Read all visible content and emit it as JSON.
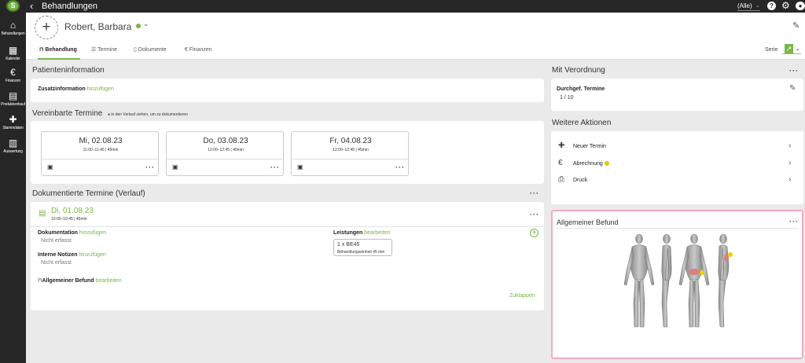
{
  "topbar": {
    "logo": "S",
    "title": "Behandlungen",
    "filter": "(Alle)"
  },
  "sidebar": {
    "items": [
      {
        "label": "Behandlungen",
        "icon": "home-icon"
      },
      {
        "label": "Kalender",
        "icon": "calendar-icon"
      },
      {
        "label": "Finanzen",
        "icon": "euro-icon"
      },
      {
        "label": "Produktverkauf",
        "icon": "document-icon"
      },
      {
        "label": "Stammdaten",
        "icon": "puzzle-icon"
      },
      {
        "label": "Auswertung",
        "icon": "chart-icon"
      }
    ]
  },
  "patient": {
    "name": "Robert, Barbara",
    "status_color": "#7ab648"
  },
  "tabs": [
    {
      "label": "Behandlung",
      "icon": "bookmark-icon"
    },
    {
      "label": "Termine",
      "icon": "list-icon"
    },
    {
      "label": "Dokumente",
      "icon": "file-icon"
    },
    {
      "label": "Finanzen",
      "icon": "euro-icon"
    }
  ],
  "serie_label": "Serie",
  "patienteninfo": {
    "title": "Patienteninformation",
    "zusatz_label": "Zusatzinformation",
    "zusatz_action": "hinzufügen"
  },
  "vereinbarte": {
    "title": "Vereinbarte Termine",
    "hint": "in den Verlauf ziehen, um zu dokumentieren",
    "appointments": [
      {
        "date": "Mi, 02.08.23",
        "time": "11:00–11:45 | 45min"
      },
      {
        "date": "Do, 03.08.23",
        "time": "12:00–12:45 | 45min"
      },
      {
        "date": "Fr, 04.08.23",
        "time": "12:00–12:45 | 45min"
      }
    ]
  },
  "dokumentiert": {
    "title": "Dokumentierte Termine (Verlauf)",
    "entry": {
      "date": "Di, 01.08.23",
      "time": "10:00–10:45 | 45min",
      "doku_label": "Dokumentation",
      "doku_action": "hinzufügen",
      "doku_value": "Nicht erfasst",
      "notiz_label": "Interne Notizen",
      "notiz_action": "hinzufügen",
      "notiz_value": "Nicht erfasst",
      "befund_label": "Allgemeiner Befund",
      "befund_action": "bearbeiten",
      "leist_label": "Leistungen",
      "leist_action": "bearbeiten",
      "leist_item": "1 x BE45",
      "leist_sub": "Behandlungseinheit 45 min",
      "collapse": "Zuklappen"
    }
  },
  "verordnung": {
    "title": "Mit Verordnung",
    "label": "Durchgef. Termine",
    "value": "1 / 10"
  },
  "aktionen": {
    "title": "Weitere Aktionen",
    "items": [
      {
        "label": "Neuer Termin",
        "icon": "plus-icon"
      },
      {
        "label": "Abrechnung",
        "icon": "euro-icon"
      },
      {
        "label": "Druck",
        "icon": "printer-icon"
      }
    ]
  },
  "befund": {
    "title": "Allgemeiner Befund"
  },
  "colors": {
    "accent": "#7ab648",
    "dark": "#262626",
    "highlight": "#f4aac4",
    "marker": "#f0d000"
  }
}
